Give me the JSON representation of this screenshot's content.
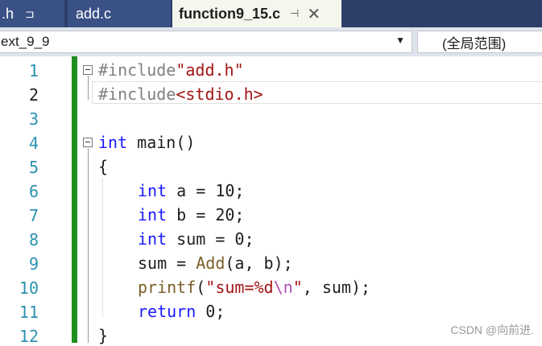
{
  "tabs": [
    {
      "label": ".h",
      "pin": "⊐"
    },
    {
      "label": "add.c"
    },
    {
      "label": "function9_15.c",
      "pin": "⊣",
      "close": "✕"
    }
  ],
  "navbar": {
    "scope": "ext_9_9",
    "dropdown_arrow": "▼",
    "function_scope": "(全局范围)"
  },
  "line_numbers": [
    "1",
    "2",
    "3",
    "4",
    "5",
    "6",
    "7",
    "8",
    "9",
    "10",
    "11",
    "12"
  ],
  "code": {
    "l1_pp": "#include",
    "l1_str": "\"add.h\"",
    "l2_pp": "#include",
    "l2_str": "<stdio.h>",
    "l4_kw": "int",
    "l4_rest": " main()",
    "l5": "{",
    "l6_kw": "int",
    "l6_rest": " a = 10;",
    "l7_kw": "int",
    "l7_rest": " b = 20;",
    "l8_kw": "int",
    "l8_rest": " sum = 0;",
    "l9_a": "sum = ",
    "l9_fn": "Add",
    "l9_b": "(a, b);",
    "l10_fn": "printf",
    "l10_p": "(",
    "l10_str1": "\"sum=%d",
    "l10_esc": "\\n",
    "l10_str2": "\"",
    "l10_rest": ", sum);",
    "l11_kw": "return",
    "l11_rest": " 0;",
    "l12": "}"
  },
  "watermark": "CSDN @向前进."
}
